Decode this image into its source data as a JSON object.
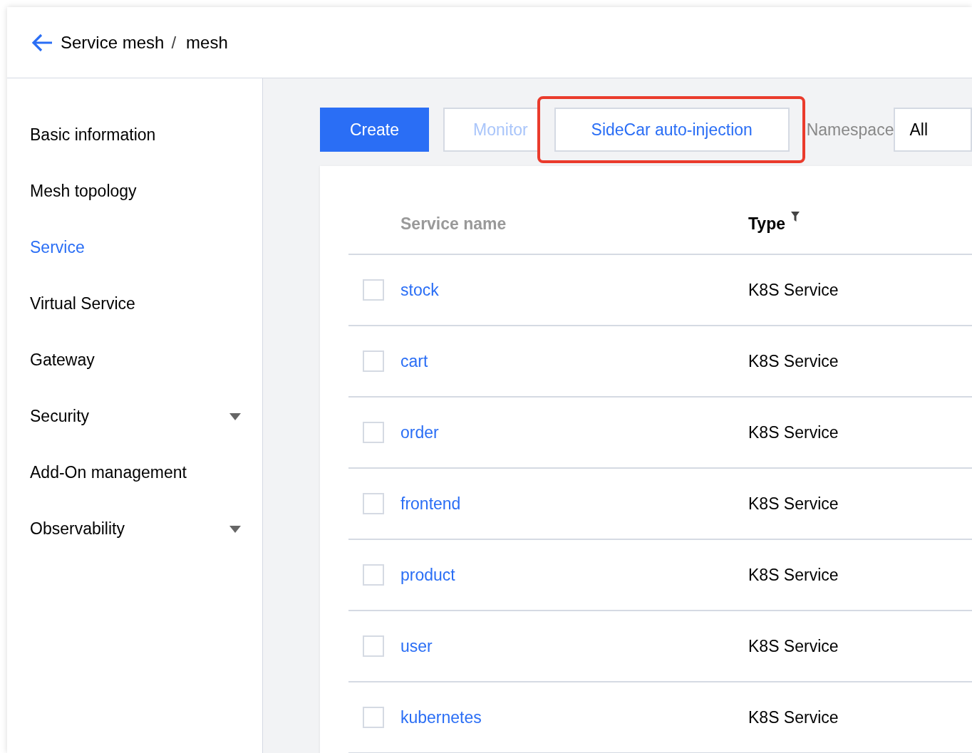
{
  "breadcrumb": {
    "parent": "Service mesh",
    "separator": "/",
    "current": "mesh"
  },
  "sidebar": {
    "items": [
      {
        "label": "Basic information",
        "selected": false,
        "expandable": false
      },
      {
        "label": "Mesh topology",
        "selected": false,
        "expandable": false
      },
      {
        "label": "Service",
        "selected": true,
        "expandable": false
      },
      {
        "label": "Virtual Service",
        "selected": false,
        "expandable": false
      },
      {
        "label": "Gateway",
        "selected": false,
        "expandable": false
      },
      {
        "label": "Security",
        "selected": false,
        "expandable": true
      },
      {
        "label": "Add-On management",
        "selected": false,
        "expandable": false
      },
      {
        "label": "Observability",
        "selected": false,
        "expandable": true
      }
    ]
  },
  "toolbar": {
    "buttons": [
      {
        "label": "Create",
        "kind": "primary",
        "disabled": false,
        "highlighted": false
      },
      {
        "label": "Monitor",
        "kind": "default",
        "disabled": true,
        "highlighted": false
      },
      {
        "label": "SideCar auto-injection",
        "kind": "default",
        "disabled": false,
        "highlighted": true
      }
    ],
    "namespace_label": "Namespace",
    "namespace_value": "All"
  },
  "table": {
    "columns": [
      {
        "label": "Service name",
        "filterable": false
      },
      {
        "label": "Type",
        "filterable": true
      }
    ],
    "rows": [
      {
        "checked": false,
        "name": "stock",
        "type": "K8S Service"
      },
      {
        "checked": false,
        "name": "cart",
        "type": "K8S Service"
      },
      {
        "checked": false,
        "name": "order",
        "type": "K8S Service"
      },
      {
        "checked": false,
        "name": "frontend",
        "type": "K8S Service"
      },
      {
        "checked": false,
        "name": "product",
        "type": "K8S Service"
      },
      {
        "checked": false,
        "name": "user",
        "type": "K8S Service"
      },
      {
        "checked": false,
        "name": "kubernetes",
        "type": "K8S Service"
      }
    ]
  }
}
